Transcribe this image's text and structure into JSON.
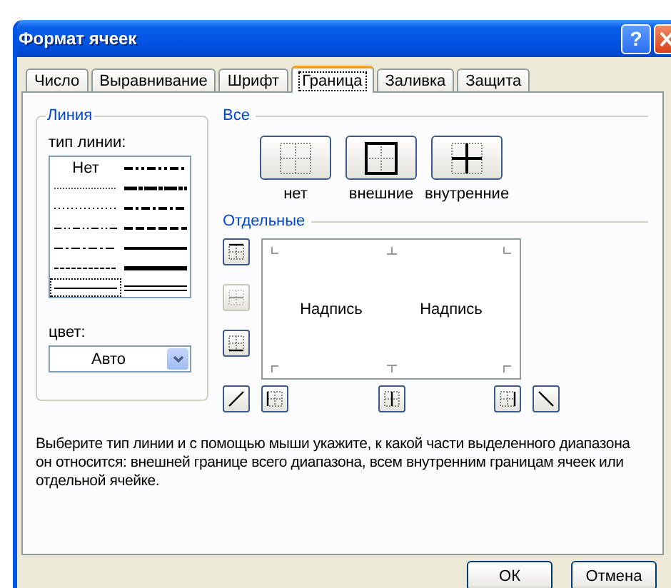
{
  "window": {
    "title": "Формат ячеек",
    "help_button": "?"
  },
  "tabs": [
    {
      "label": "Число",
      "selected": false
    },
    {
      "label": "Выравнивание",
      "selected": false
    },
    {
      "label": "Шрифт",
      "selected": false
    },
    {
      "label": "Граница",
      "selected": true
    },
    {
      "label": "Заливка",
      "selected": false
    },
    {
      "label": "Защита",
      "selected": false
    }
  ],
  "line_group": {
    "title": "Линия",
    "style_label": "тип линии:",
    "styles": [
      {
        "kind": "none",
        "label": "Нет",
        "selected": false
      },
      {
        "kind": "medium-dash-dot-dot",
        "selected": false
      },
      {
        "kind": "hair",
        "selected": false
      },
      {
        "kind": "slant-dash-dot",
        "selected": false
      },
      {
        "kind": "dotted",
        "selected": false
      },
      {
        "kind": "medium-dash-dot",
        "selected": false
      },
      {
        "kind": "dash-dot-dot",
        "selected": false
      },
      {
        "kind": "medium-dashed",
        "selected": false
      },
      {
        "kind": "dash-dot",
        "selected": false
      },
      {
        "kind": "medium",
        "selected": false
      },
      {
        "kind": "dashed",
        "selected": false
      },
      {
        "kind": "thick",
        "selected": false
      },
      {
        "kind": "thin",
        "selected": true
      },
      {
        "kind": "double",
        "selected": false
      }
    ],
    "color_label": "цвет:",
    "color": {
      "value": "Авто"
    }
  },
  "presets": {
    "title": "Все",
    "buttons": [
      {
        "kind": "none",
        "label": "нет"
      },
      {
        "kind": "outline",
        "label": "внешние"
      },
      {
        "kind": "inside",
        "label": "внутренние"
      }
    ]
  },
  "borders": {
    "title": "Отдельные",
    "buttons": [
      {
        "kind": "top",
        "disabled": false
      },
      {
        "kind": "inside-horizontal",
        "disabled": true
      },
      {
        "kind": "bottom",
        "disabled": false
      },
      {
        "kind": "diagonal-up",
        "disabled": false
      },
      {
        "kind": "left",
        "disabled": false
      },
      {
        "kind": "inside-vertical",
        "disabled": false
      },
      {
        "kind": "right",
        "disabled": false
      },
      {
        "kind": "diagonal-down",
        "disabled": false
      }
    ],
    "preview_texts": [
      "Надпись",
      "Надпись"
    ]
  },
  "description": "Выберите тип линии и с помощью мыши укажите, к какой части выделенного диапазона он относится: внешней границе всего диапазона, всем внутренним границам ячеек или отдельной ячейке.",
  "buttons": [
    {
      "label": "ОК"
    },
    {
      "label": "Отмена"
    }
  ]
}
